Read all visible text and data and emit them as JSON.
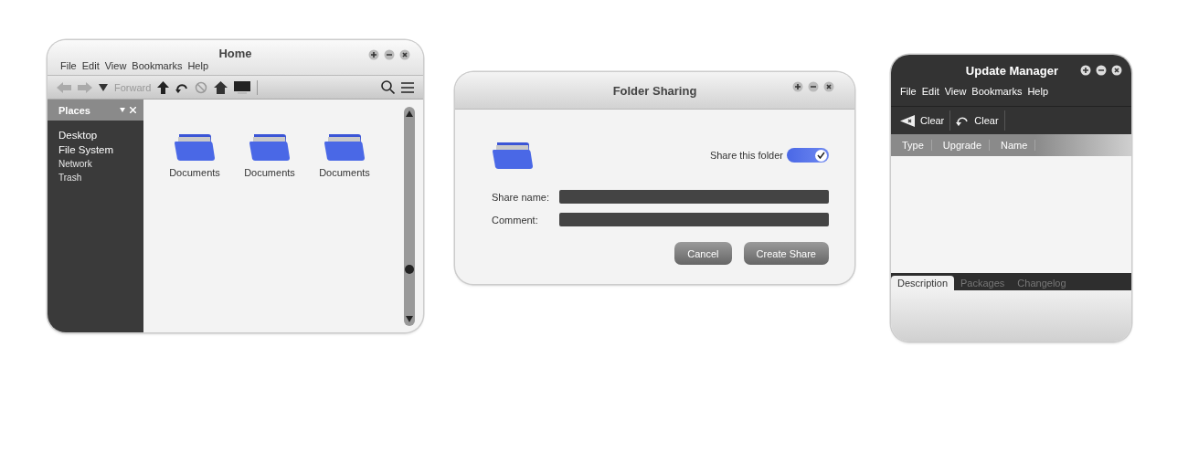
{
  "file_manager": {
    "title": "Home",
    "menu": [
      "File",
      "Edit",
      "View",
      "Bookmarks",
      "Help"
    ],
    "toolbar": {
      "back_disabled": true,
      "forward_disabled": true,
      "forward_label": "Forward"
    },
    "sidebar": {
      "title": "Places",
      "items": [
        {
          "label": "Desktop",
          "prominent": true
        },
        {
          "label": "File System",
          "prominent": true
        },
        {
          "label": "Network",
          "prominent": false
        },
        {
          "label": "Trash",
          "prominent": false
        }
      ]
    },
    "files": [
      {
        "name": "Documents"
      },
      {
        "name": "Documents"
      },
      {
        "name": "Documents"
      }
    ]
  },
  "folder_sharing": {
    "title": "Folder Sharing",
    "share_toggle": {
      "label": "Share this folder",
      "on": true
    },
    "fields": [
      {
        "label": "Share name:"
      },
      {
        "label": "Comment:"
      }
    ],
    "buttons": [
      "Cancel",
      "Create Share"
    ]
  },
  "update_manager": {
    "title": "Update Manager",
    "menu": [
      "File",
      "Edit",
      "View",
      "Bookmarks",
      "Help"
    ],
    "toolbar": [
      {
        "kind": "clear",
        "label": "Clear"
      },
      {
        "kind": "revert",
        "label": "Clear"
      }
    ],
    "columns": [
      "Type",
      "Upgrade",
      "Name"
    ],
    "tabs": [
      {
        "label": "Description",
        "selected": true
      },
      {
        "label": "Packages",
        "selected": false
      },
      {
        "label": "Changelog",
        "selected": false
      }
    ]
  }
}
